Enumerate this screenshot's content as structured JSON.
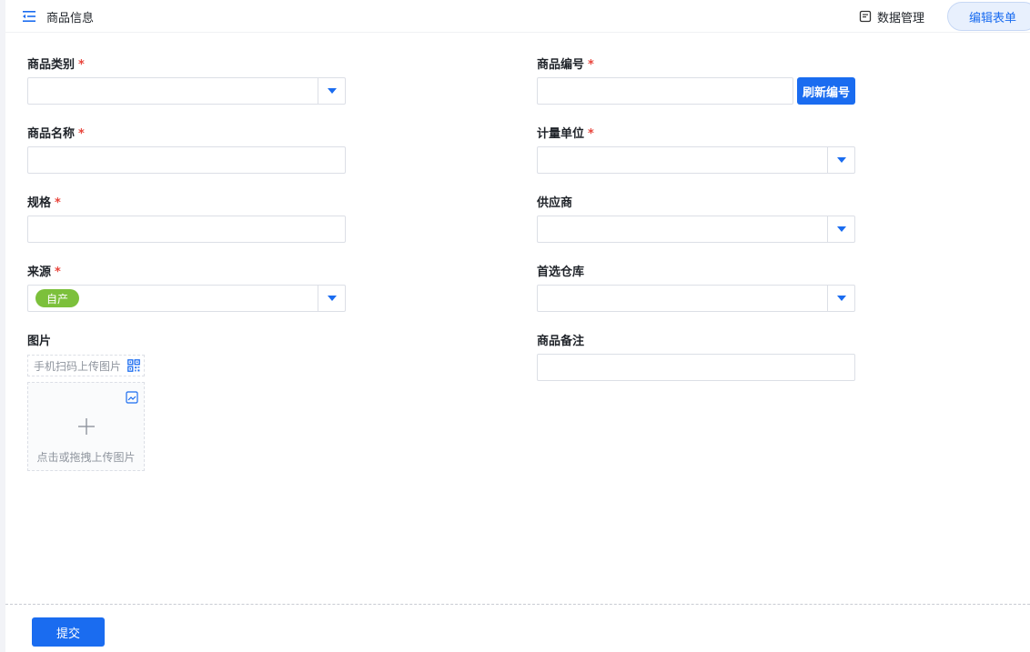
{
  "header": {
    "title": "商品信息",
    "data_mgmt_label": "数据管理",
    "edit_form_label": "编辑表单"
  },
  "form": {
    "left": {
      "category": {
        "label": "商品类别",
        "required": "*",
        "value": ""
      },
      "name": {
        "label": "商品名称",
        "required": "*",
        "value": ""
      },
      "spec": {
        "label": "规格",
        "required": "*",
        "value": ""
      },
      "source": {
        "label": "来源",
        "required": "*",
        "tag": "自产"
      },
      "image": {
        "label": "图片",
        "scan_text": "手机扫码上传图片",
        "upload_text": "点击或拖拽上传图片"
      }
    },
    "right": {
      "code": {
        "label": "商品编号",
        "required": "*",
        "value": "",
        "refresh_label": "刷新编号"
      },
      "unit": {
        "label": "计量单位",
        "required": "*",
        "value": ""
      },
      "supplier": {
        "label": "供应商",
        "value": ""
      },
      "warehouse": {
        "label": "首选仓库",
        "value": ""
      },
      "remark": {
        "label": "商品备注",
        "value": ""
      }
    }
  },
  "footer": {
    "submit_label": "提交"
  },
  "colors": {
    "accent": "#1a6cf0",
    "required": "#e8453c",
    "tag": "#7cc03b"
  },
  "icons": {
    "menu": "menu-collapse-icon",
    "data_mgmt": "document-icon",
    "qr": "qr-code-icon",
    "image": "image-icon",
    "plus": "plus-icon",
    "dropdown": "caret-down-icon"
  }
}
